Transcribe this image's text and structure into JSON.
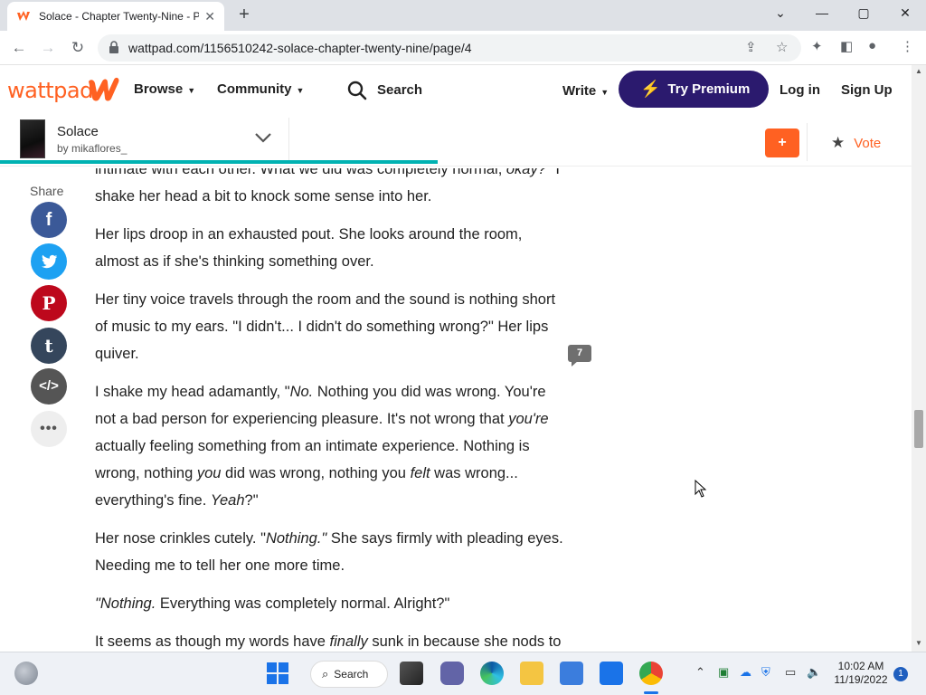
{
  "browser": {
    "tab_title": "Solace - Chapter Twenty-Nine - P",
    "tab_close": "✕",
    "new_tab": "+",
    "url": "wattpad.com/1156510242-solace-chapter-twenty-nine/page/4",
    "window": {
      "minimize": "—",
      "maximize": "▢",
      "close": "✕",
      "tabsearch": "⌄"
    }
  },
  "header": {
    "logo": "wattpad",
    "browse": "Browse",
    "community": "Community",
    "search": "Search",
    "write": "Write",
    "premium": "Try Premium",
    "login": "Log in",
    "signup": "Sign Up",
    "accent_color": "#ff6122",
    "premium_color": "#2b1a6e"
  },
  "story": {
    "title": "Solace",
    "author": "by mikaflores_",
    "add": "+",
    "vote": "Vote",
    "progress_fraction": 0.48
  },
  "share": {
    "label": "Share",
    "buttons": [
      {
        "name": "facebook",
        "glyph": "f",
        "color": "#3b5998"
      },
      {
        "name": "twitter",
        "glyph": "🐦",
        "color": "#1da1f2"
      },
      {
        "name": "pinterest",
        "glyph": "P",
        "color": "#bd081c"
      },
      {
        "name": "tumblr",
        "glyph": "t",
        "color": "#35465c"
      },
      {
        "name": "embed",
        "glyph": "</>",
        "color": "#555555"
      },
      {
        "name": "more",
        "glyph": "•••",
        "color": "#eeeeee"
      }
    ]
  },
  "content": {
    "p0a": "intimate with each other. What we did was completely normal, ",
    "p0b": "okay?\"",
    "p0c": " I shake her head a bit to knock some sense into her.",
    "p1": "Her lips droop in an exhausted pout. She looks around the room, almost as if she's thinking something over.",
    "p2": "Her tiny voice travels through the room and the sound is nothing short of music to my ears. \"I didn't... I didn't do something wrong?\" Her lips quiver.",
    "p3a": "I shake my head adamantly, \"",
    "p3b": "No.",
    "p3c": " Nothing you did was wrong. You're not a bad person for experiencing pleasure. It's not wrong that ",
    "p3d": "you're",
    "p3e": " actually feeling something from an intimate experience. Nothing is wrong, nothing ",
    "p3f": "you",
    "p3g": " did was wrong, nothing you ",
    "p3h": "felt",
    "p3i": " was wrong... everything's fine. ",
    "p3j": "Yeah",
    "p3k": "?\"",
    "p4a": "Her nose crinkles cutely. \"",
    "p4b": "Nothing.\"",
    "p4c": " She says firmly with pleading eyes. Needing me to tell her one more time.",
    "p5a": "\"Nothing.",
    "p5b": " Everything was completely normal. Alright?\"",
    "p6a": "It seems as though my words have ",
    "p6b": "finally",
    "p6c": " sunk in because she nods to",
    "comment_count": "7"
  },
  "taskbar": {
    "search": "Search",
    "time": "10:02 AM",
    "date": "11/19/2022",
    "notifications": "1"
  }
}
